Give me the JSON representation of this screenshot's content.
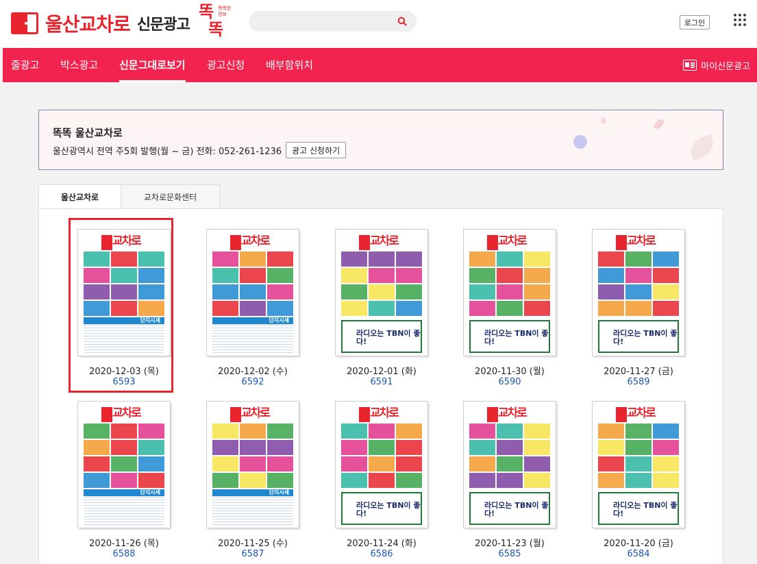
{
  "header": {
    "logo_text": "울산교차로",
    "logo_sub": "신문광고",
    "ttok_top": "똑",
    "ttok_bottom": "똑",
    "ttok_tiny": "똑똑한 정보",
    "search_placeholder": "",
    "login_label": "로그인"
  },
  "nav": {
    "items": [
      {
        "label": "줄광고"
      },
      {
        "label": "박스광고"
      },
      {
        "label": "신문그대로보기"
      },
      {
        "label": "광고신청"
      },
      {
        "label": "배부함위치"
      }
    ],
    "active_index": 2,
    "my_ad_label": "마이신문광고"
  },
  "banner": {
    "title": "똑똑 울산교차로",
    "desc": "울산광역시 전역 주5회 발행(월 ~ 금) 전화: 052-261-1236",
    "apply_label": "광고 신청하기"
  },
  "tabs": [
    {
      "label": "울산교차로",
      "active": true
    },
    {
      "label": "교차로문화센터",
      "active": false
    }
  ],
  "papers": [
    {
      "date": "2020-12-03 (목)",
      "issue": "6593",
      "variant": "table",
      "selected": true
    },
    {
      "date": "2020-12-02 (수)",
      "issue": "6592",
      "variant": "table",
      "selected": false
    },
    {
      "date": "2020-12-01 (화)",
      "issue": "6591",
      "variant": "tbn",
      "selected": false
    },
    {
      "date": "2020-11-30 (월)",
      "issue": "6590",
      "variant": "tbn",
      "selected": false
    },
    {
      "date": "2020-11-27 (금)",
      "issue": "6589",
      "variant": "tbn",
      "selected": false
    },
    {
      "date": "2020-11-26 (목)",
      "issue": "6588",
      "variant": "table",
      "selected": false
    },
    {
      "date": "2020-11-25 (수)",
      "issue": "6587",
      "variant": "table",
      "selected": false
    },
    {
      "date": "2020-11-24 (화)",
      "issue": "6586",
      "variant": "tbn",
      "selected": false
    },
    {
      "date": "2020-11-23 (월)",
      "issue": "6585",
      "variant": "tbn",
      "selected": false
    },
    {
      "date": "2020-11-20 (금)",
      "issue": "6584",
      "variant": "tbn",
      "selected": false
    }
  ],
  "paper_masthead": "교차로",
  "table_label": "단지시세",
  "tbn_text": "라디오는 TBN이 좋다!",
  "colors": {
    "brand_red": "#e8242f",
    "nav_pink": "#f2234f",
    "link_blue": "#1a56b0"
  }
}
